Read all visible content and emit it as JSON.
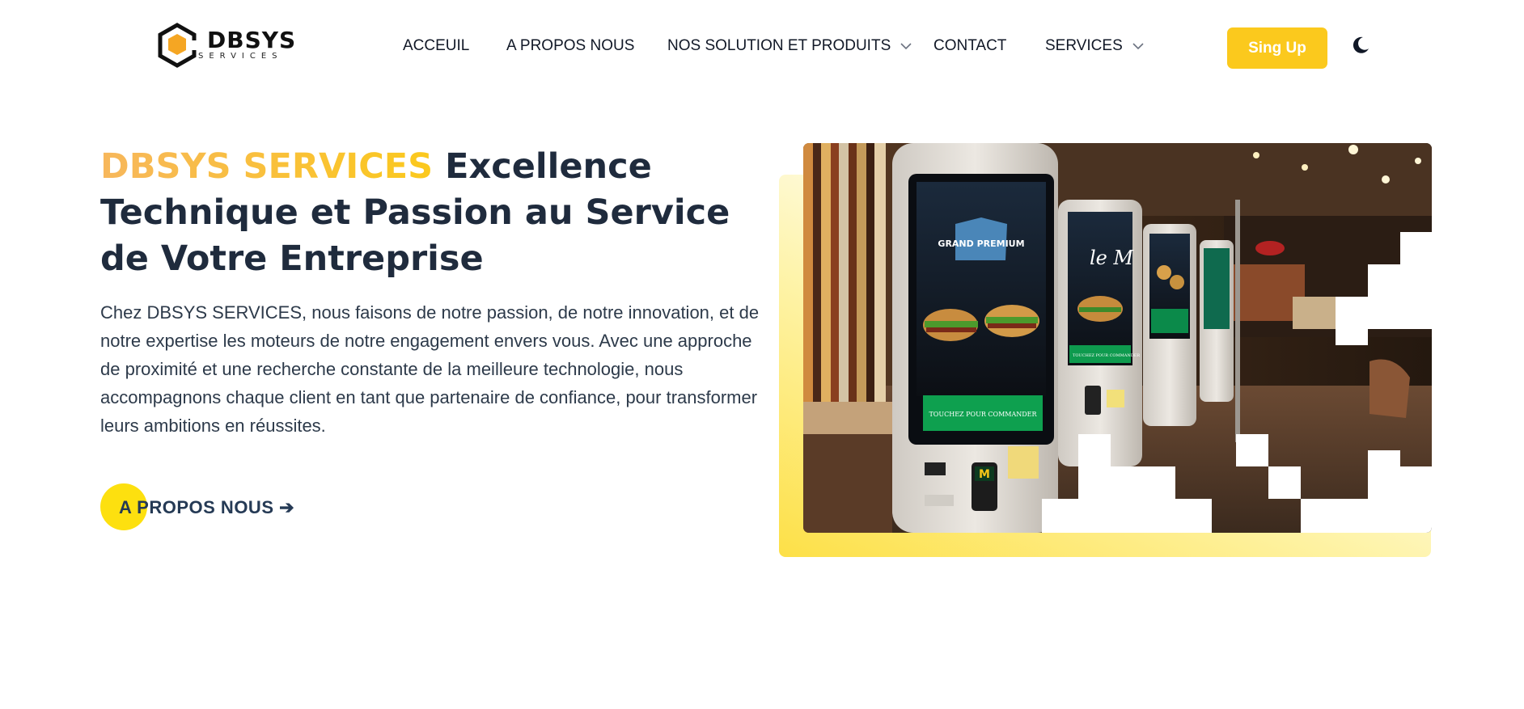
{
  "brand": {
    "name": "DBSYS",
    "subtitle": "SERVICES",
    "colors": {
      "accent": "#fbc91d",
      "accent_gradient_start": "#f7b75c",
      "heading": "#1f2b3d",
      "text": "#2d3a4a",
      "cta_circle": "#fde00f",
      "cta_text": "#253a55"
    }
  },
  "nav": {
    "items": [
      {
        "label": "ACCEUIL",
        "has_dropdown": false
      },
      {
        "label": "A PROPOS NOUS",
        "has_dropdown": false
      },
      {
        "label": "NOS SOLUTION ET PRODUITS",
        "has_dropdown": true
      },
      {
        "label": "CONTACT",
        "has_dropdown": false
      },
      {
        "label": "SERVICES",
        "has_dropdown": true
      }
    ],
    "signup_label": "Sing Up",
    "theme_icon": "moon-icon",
    "dropdown_icon": "chevron-down-icon"
  },
  "hero": {
    "title_accent": "DBSYS SERVICES",
    "title_rest": " Excellence Technique et Passion au Service de Votre Entreprise",
    "text": "Chez DBSYS SERVICES, nous faisons de notre passion, de notre innovation, et de notre expertise les moteurs de notre engagement envers vous. Avec une approche de proximité et une recherche constante de la meilleure technologie, nous accompagnons chaque client en tant que partenaire de confiance, pour transformer leurs ambitions en réussites.",
    "cta_label": "A PROPOS NOUS ➔",
    "image": {
      "kiosk_screen_1_badge": "GRAND PREMIUM",
      "kiosk_screen_1_footer": "TOUCHEZ POUR COMMANDER",
      "kiosk_screen_2_title": "le M",
      "kiosk_screen_2_footer": "TOUCHEZ POUR COMMANDER"
    }
  }
}
